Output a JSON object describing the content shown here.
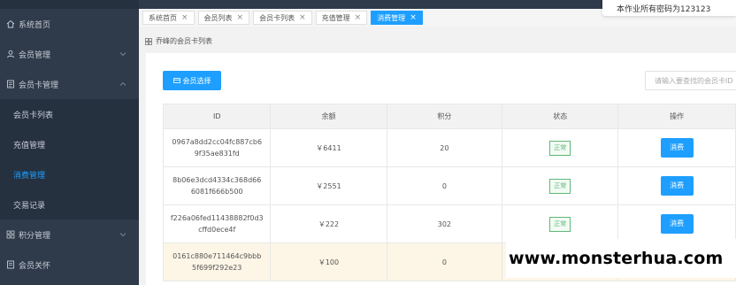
{
  "sidebar": {
    "items": [
      {
        "label": "系统首页",
        "icon": "home-icon"
      },
      {
        "label": "会员管理",
        "icon": "user-icon"
      },
      {
        "label": "会员卡管理",
        "icon": "card-icon"
      },
      {
        "label": "会员卡列表"
      },
      {
        "label": "充值管理"
      },
      {
        "label": "消费管理"
      },
      {
        "label": "交易记录"
      },
      {
        "label": "积分管理",
        "icon": "grid-icon"
      },
      {
        "label": "会员关怀",
        "icon": "list-icon"
      }
    ]
  },
  "notice": "本作业所有密码为123123",
  "tabs": [
    {
      "label": "系统首页"
    },
    {
      "label": "会员列表"
    },
    {
      "label": "会员卡列表"
    },
    {
      "label": "充值管理"
    },
    {
      "label": "消费管理"
    }
  ],
  "breadcrumb": "乔峰的会员卡列表",
  "toolbar": {
    "select_label": "会员选择",
    "search_placeholder": "请输入要查找的会员卡ID"
  },
  "table": {
    "headers": [
      "ID",
      "余额",
      "积分",
      "状态",
      "操作"
    ],
    "rows": [
      {
        "id_line1": "0967a8dd2cc04fc887cb6",
        "id_line2": "9f35ae831fd",
        "balance": "￥6411",
        "points": "20",
        "status": "正常",
        "action": "消费"
      },
      {
        "id_line1": "8b06e3dcd4334c368d66",
        "id_line2": "6081f666b500",
        "balance": "￥2551",
        "points": "0",
        "status": "正常",
        "action": "消费"
      },
      {
        "id_line1": "f226a06fed11438882f0d3",
        "id_line2": "cffd0ece4f",
        "balance": "￥222",
        "points": "302",
        "status": "正常",
        "action": "消费"
      },
      {
        "id_line1": "0161c880e711464c9bbb",
        "id_line2": "5f699f292e23",
        "balance": "￥100",
        "points": "0"
      }
    ]
  },
  "watermark": "www.monsterhua.com",
  "colors": {
    "accent": "#1e9fff",
    "sidebar": "#2f3a4a",
    "success": "#5fb878"
  }
}
